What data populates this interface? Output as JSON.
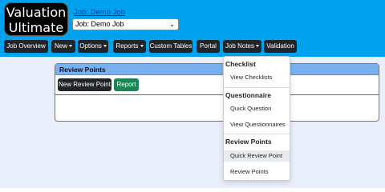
{
  "header": {
    "logo_line1": "Valuation",
    "logo_line2": "Ultimate",
    "job_link": "Job: Demo Job",
    "job_select_value": "Job: Demo Job"
  },
  "nav": {
    "job_overview": "Job Overview",
    "new": "New",
    "options": "Options",
    "reports": "Reports",
    "custom_tables": "Custom Tables",
    "portal": "Portal",
    "job_notes": "Job Notes",
    "validation": "Validation"
  },
  "panel": {
    "title": "Review Points",
    "new_review_point": "New Review Point",
    "report": "Report"
  },
  "dropdown": {
    "checklist_header": "Checklist",
    "view_checklists": "View Checklists",
    "questionnaire_header": "Questionnaire",
    "quick_question": "Quick Question",
    "view_questionnaires": "View Questionnaires",
    "review_points_header": "Review Points",
    "quick_review_point": "Quick Review Point",
    "review_points": "Review Points"
  },
  "colors": {
    "header_bg": "#00a2ed",
    "nav_button": "#212529",
    "panel_header": "#79b1ee",
    "report_button": "#198754"
  }
}
